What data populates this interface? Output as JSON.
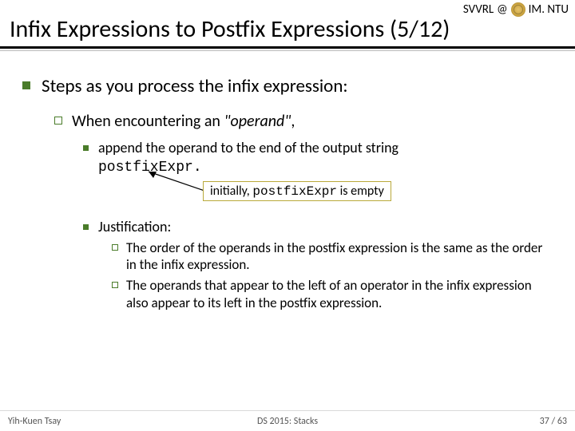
{
  "header": {
    "org_left": "SVVRL",
    "at": "@",
    "org_right": "IM. NTU",
    "title": "Infix Expressions to Postfix Expressions (5/12)"
  },
  "body": {
    "l1": "Steps as you process the infix expression:",
    "l2_prefix": "When encountering an ",
    "l2_quoted": "\"operand\"",
    "l2_suffix": ",",
    "l3a_prefix": "append the operand to the end of the output string ",
    "l3a_code": "postfixExpr.",
    "callout_prefix": "initially, ",
    "callout_code": "postfixExpr",
    "callout_suffix": " is empty",
    "l3b": "Justification:",
    "l4a": "The order of the operands in the postfix expression is the same as the order in the infix expression.",
    "l4b": "The operands that appear to the left of an operator in the infix expression also appear to its left in the postfix expression."
  },
  "footer": {
    "left": "Yih-Kuen Tsay",
    "center": "DS 2015: Stacks",
    "right": "37 / 63"
  }
}
